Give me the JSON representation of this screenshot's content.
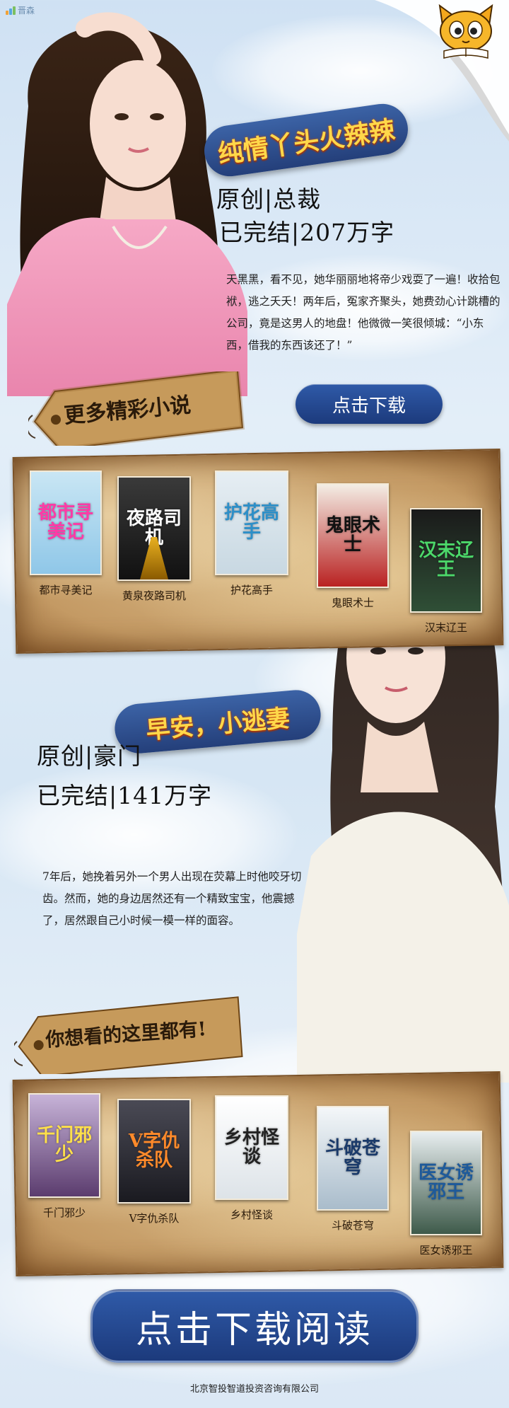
{
  "brand": {
    "logo_text": "晋森"
  },
  "featured1": {
    "title": "纯情丫头火辣辣",
    "genre": "原创|总裁",
    "status": "已完结|207万字",
    "desc": "天黑黑，看不见，她华丽丽地将帝少戏耍了一遍！收拾包袱，逃之夭夭！两年后，冤家齐聚头，她费劲心计跳槽的公司，竟是这男人的地盘！他微微一笑很倾城：“小东西，借我的东西该还了！”"
  },
  "tag1": {
    "label": "更多精彩小说"
  },
  "download_small": {
    "label": "点击下载"
  },
  "shelf1": {
    "books": [
      {
        "name": "都市寻美记",
        "cover_title": "都市寻美记",
        "color": "#8fc7e8"
      },
      {
        "name": "黄泉夜路司机",
        "cover_title": "夜路司机",
        "color": "#2b2b2b"
      },
      {
        "name": "护花高手",
        "cover_title": "护花高手",
        "color": "#d7e3ea"
      },
      {
        "name": "鬼眼术士",
        "cover_title": "鬼眼术士",
        "color": "#b92222"
      },
      {
        "name": "汉末辽王",
        "cover_title": "汉末辽王",
        "color": "#2f4f36"
      }
    ]
  },
  "featured2": {
    "title": "早安，小逃妻",
    "genre": "原创|豪门",
    "status": "已完结|141万字",
    "desc": "7年后，她挽着另外一个男人出现在荧幕上时他咬牙切齿。然而，她的身边居然还有一个精致宝宝，他震撼了，居然跟自己小时候一模一样的面容。"
  },
  "tag2": {
    "label": "你想看的这里都有!"
  },
  "shelf2": {
    "books": [
      {
        "name": "千门邪少",
        "cover_title": "千门邪少",
        "color": "#5b3c6e"
      },
      {
        "name": "V字仇杀队",
        "cover_title": "V字仇杀队",
        "color": "#2a2a30"
      },
      {
        "name": "乡村怪谈",
        "cover_title": "乡村怪谈",
        "color": "#eef1f3"
      },
      {
        "name": "斗破苍穹",
        "cover_title": "斗破苍穹",
        "color": "#dfe8ee"
      },
      {
        "name": "医女诱邪王",
        "cover_title": "医女诱邪王",
        "color": "#3e5a4a"
      }
    ]
  },
  "download_big": {
    "label": "点击下载阅读"
  },
  "footer": {
    "company": "北京智投智道投资咨询有限公司"
  },
  "colors": {
    "accent_blue": "#2a4a8e",
    "title_yellow": "#ffd84a",
    "parchment": "#c49a64"
  }
}
